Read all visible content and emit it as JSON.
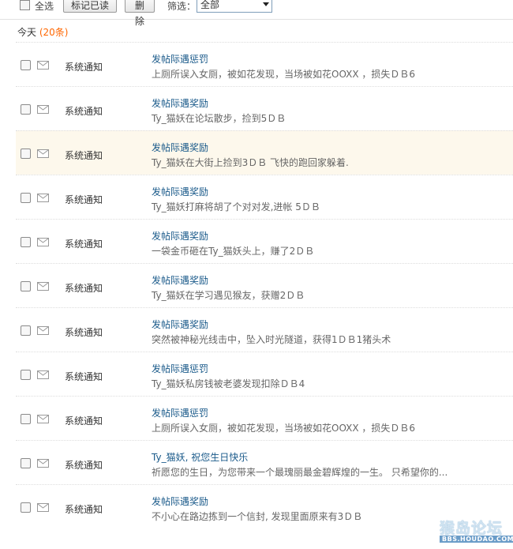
{
  "toolbar": {
    "select_all_label": "全选",
    "mark_read_label": "标记已读",
    "delete_label": "删除",
    "filter_label": "筛选：",
    "filter_value": "全部"
  },
  "section": {
    "label": "今天",
    "count": "(20条)"
  },
  "messages": [
    {
      "sender": "系统通知",
      "title": "发帖际遇惩罚",
      "summary": "上厕所误入女厕，被如花发现，当场被如花OOXX ，损失ＤＢ6"
    },
    {
      "sender": "系统通知",
      "title": "发帖际遇奖励",
      "summary": "Ty_猫妖在论坛散步，捡到5ＤＢ"
    },
    {
      "sender": "系统通知",
      "title": "发帖际遇奖励",
      "summary": "Ty_猫妖在大街上捡到3ＤＢ  飞快的跑回家躲着."
    },
    {
      "sender": "系统通知",
      "title": "发帖际遇奖励",
      "summary": "Ty_猫妖打麻将胡了个对对发,进帐 5ＤＢ"
    },
    {
      "sender": "系统通知",
      "title": "发帖际遇奖励",
      "summary": "一袋金币砸在Ty_猫妖头上，赚了2ＤＢ"
    },
    {
      "sender": "系统通知",
      "title": "发帖际遇奖励",
      "summary": "Ty_猫妖在学习遇见猴友，获赠2ＤＢ"
    },
    {
      "sender": "系统通知",
      "title": "发帖际遇奖励",
      "summary": "突然被神秘光线击中，坠入时光隧道，获得1ＤＢ1猪头术"
    },
    {
      "sender": "系统通知",
      "title": "发帖际遇惩罚",
      "summary": "Ty_猫妖私房钱被老婆发现扣除ＤＢ4"
    },
    {
      "sender": "系统通知",
      "title": "发帖际遇惩罚",
      "summary": "上厕所误入女厕，被如花发现，当场被如花OOXX ，损失ＤＢ6"
    },
    {
      "sender": "系统通知",
      "title": "Ty_猫妖, 祝您生日快乐",
      "summary": "祈愿您的生日，为您带来一个最瑰丽最金碧辉煌的一生。 只希望你的..."
    },
    {
      "sender": "系统通知",
      "title": "发帖际遇奖励",
      "summary": "不小心在路边拣到一个信封, 发现里面原来有3ＤＢ"
    }
  ],
  "watermark": {
    "title": "猴岛论坛",
    "url": "BBS.HOUDAO.COM"
  }
}
